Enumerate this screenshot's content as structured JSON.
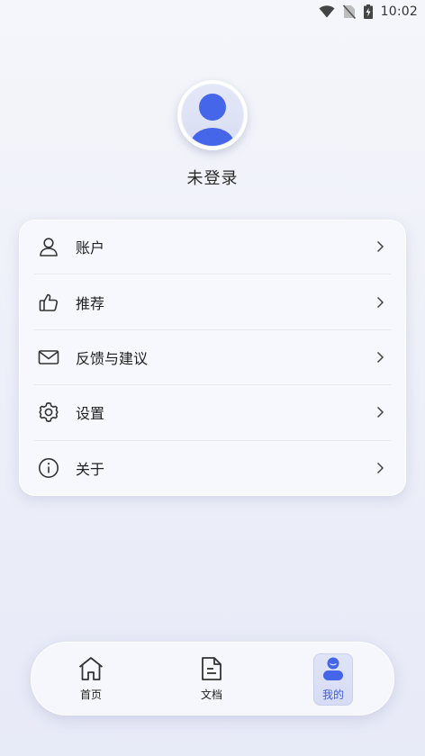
{
  "status_bar": {
    "time": "10:02",
    "icons": [
      "wifi-icon",
      "no-sim-icon",
      "battery-charging-icon"
    ]
  },
  "profile": {
    "avatar_icon": "default-user-avatar-icon",
    "login_status": "未登录"
  },
  "menu": {
    "items": [
      {
        "id": "account",
        "label": "账户",
        "icon": "user-icon"
      },
      {
        "id": "recommend",
        "label": "推荐",
        "icon": "thumbs-up-icon"
      },
      {
        "id": "feedback",
        "label": "反馈与建议",
        "icon": "mail-icon"
      },
      {
        "id": "settings",
        "label": "设置",
        "icon": "gear-icon"
      },
      {
        "id": "about",
        "label": "关于",
        "icon": "info-icon"
      }
    ]
  },
  "bottom_nav": {
    "items": [
      {
        "id": "home",
        "label": "首页",
        "icon": "home-icon",
        "active": false
      },
      {
        "id": "docs",
        "label": "文档",
        "icon": "document-icon",
        "active": false
      },
      {
        "id": "mine",
        "label": "我的",
        "icon": "profile-icon",
        "active": true
      }
    ]
  },
  "colors": {
    "accent": "#3d5ce0",
    "avatar_blue": "#4566e8",
    "background": "#eef0f9",
    "card": "#f7f8fd"
  }
}
